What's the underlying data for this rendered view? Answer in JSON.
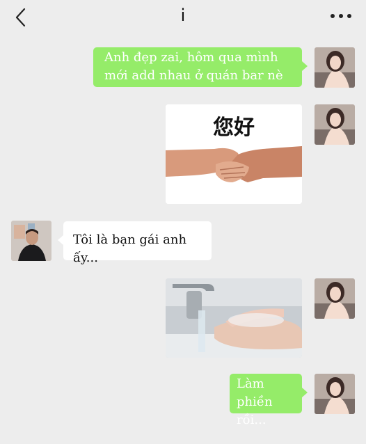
{
  "header": {
    "title": "i"
  },
  "messages": {
    "m1": {
      "text_line1": "Anh đẹp zai, hôm qua mình",
      "text_line2": "mới add nhau ở quán bar nè"
    },
    "m2": {
      "caption": "您好"
    },
    "m3": {
      "text": "Tôi là bạn gái anh ấy..."
    },
    "m5": {
      "text_line1": "Làm phiền",
      "text_line2": "rồi..."
    }
  },
  "colors": {
    "background": "#ededed",
    "sent_bubble": "#95ec69",
    "received_bubble": "#ffffff"
  },
  "icons": {
    "back": "chevron-left-icon",
    "more": "more-dots-icon"
  }
}
